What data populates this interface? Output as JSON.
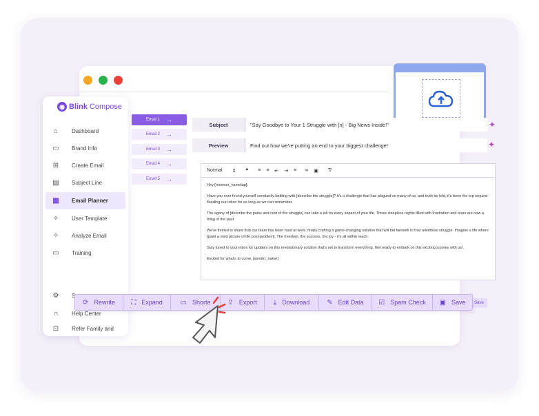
{
  "brand": {
    "name_bold": "Blink",
    "name_rest": "Compose"
  },
  "sidebar": {
    "items": [
      {
        "label": "Dashboard",
        "icon": "home-icon"
      },
      {
        "label": "Brand Info",
        "icon": "chat-icon"
      },
      {
        "label": "Create Email",
        "icon": "document-plus-icon"
      },
      {
        "label": "Subject Line",
        "icon": "document-icon"
      },
      {
        "label": "Email Planner",
        "icon": "calendar-icon",
        "active": true
      },
      {
        "label": "User Template",
        "icon": "sparkle-icon"
      },
      {
        "label": "Analyze Email",
        "icon": "sparkle-icon"
      },
      {
        "label": "Training",
        "icon": "message-icon"
      }
    ],
    "lower_items": [
      {
        "label": "S",
        "icon": "gear-icon"
      },
      {
        "label": "Help Center",
        "icon": "headset-icon"
      },
      {
        "label": "Refer Family and",
        "icon": "gift-icon"
      }
    ]
  },
  "emails": [
    "Email 1",
    "Email 2",
    "Email 3",
    "Email 4",
    "Email 5"
  ],
  "subject": {
    "label": "Subject",
    "value": "\"Say Goodbye to Your 1 Struggle with [n] - Big News Inside!\""
  },
  "preview": {
    "label": "Preview",
    "value": "Find out how we're putting an end to your biggest challenge!"
  },
  "editor": {
    "format": "Normal",
    "paragraphs": [
      "Hey [receiver_nametag],",
      "Have you ever found yourself constantly battling with [describe the struggle]? It's a challenge that has plagued so many of us, and truth be told, it's been the top request flooding our inbox for as long as we can remember.",
      "The agony of [describe the pains and cost of the struggle] can take a toll on every aspect of your life. Those sleepless nights filled with frustration and tears are now a thing of the past.",
      "We're thrilled to share that our team has been hard at work, finally crafting a game-changing solution that will bid farewell to that relentless struggle. Imagine a life where [paint a vivid picture of life post-problem]. The freedom, the success, the joy - it's all within reach.",
      "Stay tuned to your inbox for updates on this revolutionary solution that's set to transform everything. Get ready to embark on this exciting journey with us!.",
      "Excited for what's to come, [sender_name]"
    ]
  },
  "actions": [
    {
      "label": "Rewrite",
      "icon": "refresh-icon"
    },
    {
      "label": "Expand",
      "icon": "expand-icon"
    },
    {
      "label": "Shorte",
      "icon": "shorten-icon"
    },
    {
      "label": "Export",
      "icon": "export-icon"
    },
    {
      "label": "Download",
      "icon": "download-icon"
    },
    {
      "label": "Edit Data",
      "icon": "edit-icon"
    },
    {
      "label": "Spam Check",
      "icon": "spam-check-icon"
    },
    {
      "label": "Save",
      "icon": "save-icon"
    }
  ],
  "save_mini": "Save",
  "colors": {
    "accent": "#7a4ae0",
    "dot_yellow": "#f5a623",
    "dot_green": "#2bb24c",
    "dot_red": "#e8413c"
  }
}
